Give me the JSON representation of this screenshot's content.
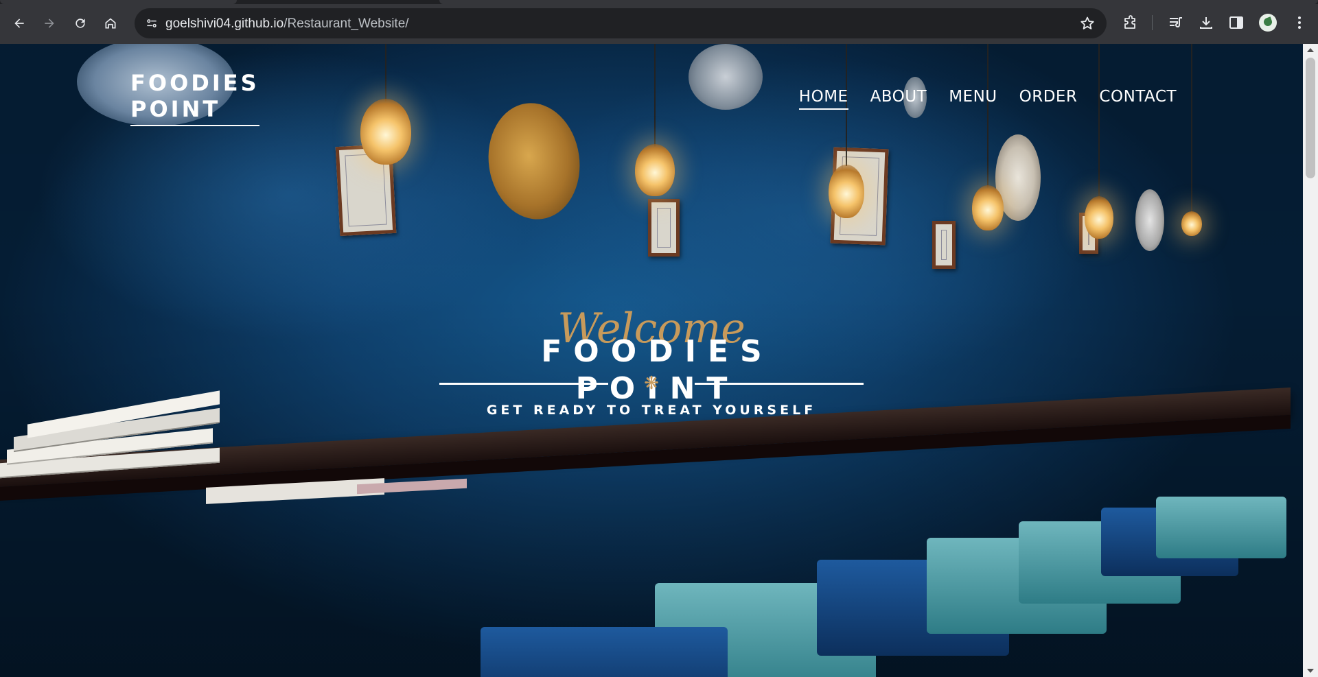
{
  "browser": {
    "url_host": "goelshivi04.github.io",
    "url_path": "/Restaurant_Website/",
    "icons": [
      "back-icon",
      "forward-icon",
      "reload-icon",
      "home-icon",
      "site-info-icon",
      "bookmark-star-icon",
      "extensions-icon",
      "reading-list-icon",
      "downloads-icon",
      "side-panel-icon",
      "profile-avatar",
      "more-menu-icon"
    ]
  },
  "site": {
    "logo_line1": "FOODIES",
    "logo_line2": "POINT",
    "nav": [
      {
        "label": "HOME",
        "active": true
      },
      {
        "label": "ABOUT",
        "active": false
      },
      {
        "label": "MENU",
        "active": false
      },
      {
        "label": "ORDER",
        "active": false
      },
      {
        "label": "CONTACT",
        "active": false
      }
    ]
  },
  "hero": {
    "welcome": "Welcome",
    "brand": "FOODIES POINT",
    "tagline": "GET READY TO TREAT YOURSELF",
    "divider_ornament": "❋"
  },
  "colors": {
    "accent_gold": "#c79a5b",
    "hero_blue": "#0f4270",
    "chrome_bg": "#35363a",
    "omnibox_bg": "#202124"
  }
}
